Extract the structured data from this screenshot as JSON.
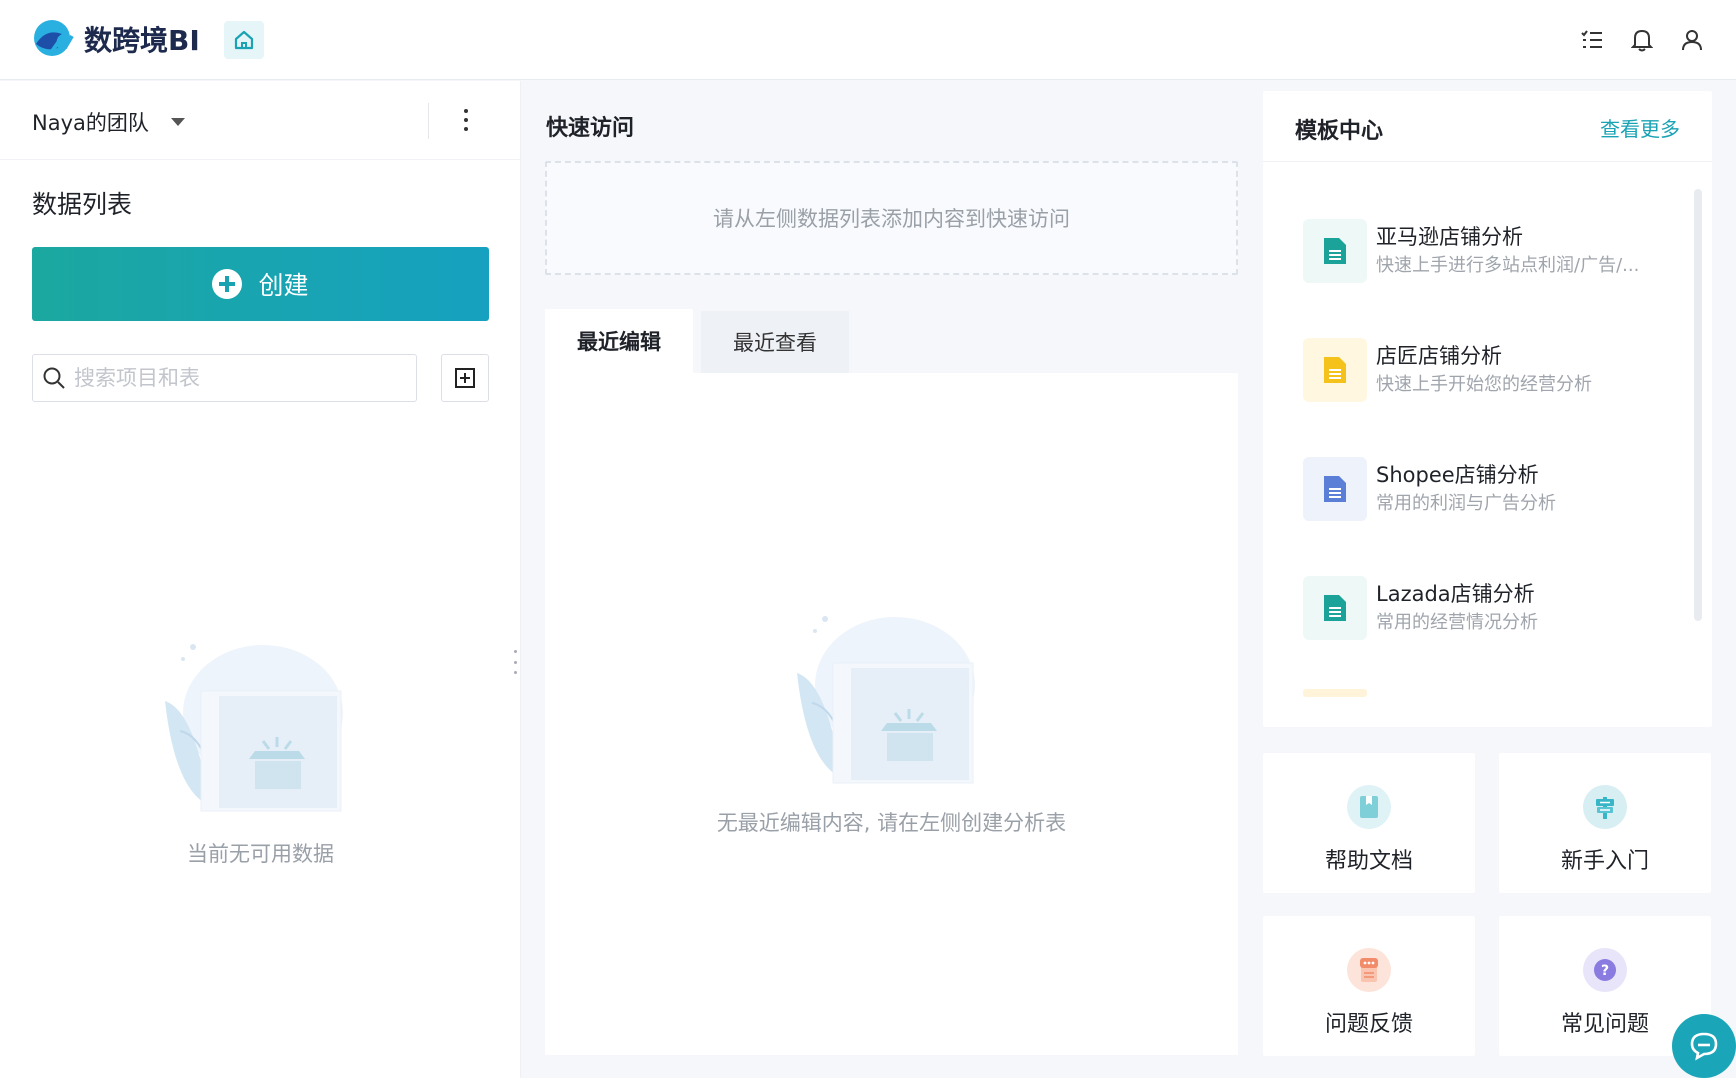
{
  "header": {
    "app_name": "数跨境BI",
    "icons": [
      "home-icon",
      "task-list-icon",
      "bell-icon",
      "user-icon"
    ]
  },
  "sidebar": {
    "team_name": "Naya的团队",
    "section_title": "数据列表",
    "create_label": "创建",
    "search_placeholder": "搜索项目和表",
    "empty_text": "当前无可用数据"
  },
  "main": {
    "quick_access_title": "快速访问",
    "quick_access_empty": "请从左侧数据列表添加内容到快速访问",
    "tabs": [
      {
        "label": "最近编辑",
        "active": true
      },
      {
        "label": "最近查看",
        "active": false
      }
    ],
    "empty_text": "无最近编辑内容, 请在左侧创建分析表"
  },
  "templates": {
    "title": "模板中心",
    "more_label": "查看更多",
    "items": [
      {
        "name": "亚马逊店铺分析",
        "desc": "快速上手进行多站点利润/广告/...",
        "color": "#1ba39a",
        "bg": "#eef8f7"
      },
      {
        "name": "店匠店铺分析",
        "desc": "快速上手开始您的经营分析",
        "color": "#f5c21b",
        "bg": "#fff7e0"
      },
      {
        "name": "Shopee店铺分析",
        "desc": "常用的利润与广告分析",
        "color": "#5b7fd6",
        "bg": "#eef2fb"
      },
      {
        "name": "Lazada店铺分析",
        "desc": "常用的经营情况分析",
        "color": "#1ba39a",
        "bg": "#eef8f7"
      }
    ]
  },
  "tiles": [
    {
      "label": "帮助文档",
      "icon": "help-doc-icon",
      "color": "#7ecfd8"
    },
    {
      "label": "新手入门",
      "icon": "beginner-icon",
      "color": "#38b6c8"
    },
    {
      "label": "问题反馈",
      "icon": "feedback-icon",
      "color": "#f28b6a"
    },
    {
      "label": "常见问题",
      "icon": "faq-icon",
      "color": "#8a7be0"
    }
  ],
  "colors": {
    "accent": "#1aa3b4",
    "create_gradient_start": "#1ba8a0",
    "create_gradient_end": "#16a1c0"
  }
}
